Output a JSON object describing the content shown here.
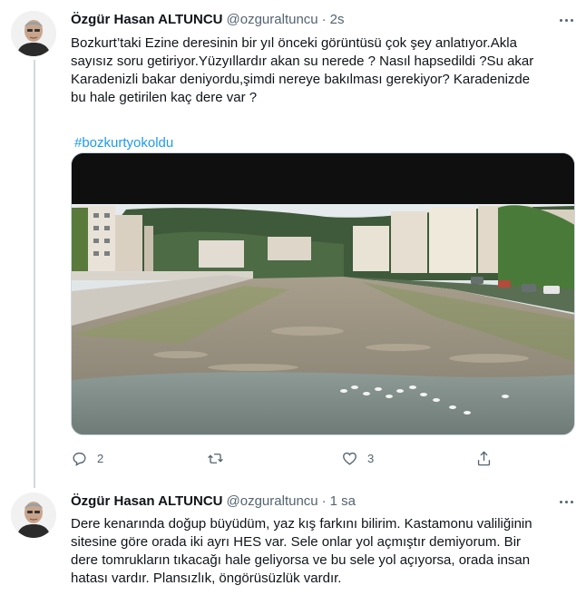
{
  "tweets": [
    {
      "author_name": "Özgür Hasan ALTUNCU",
      "handle": "@ozguraltuncu",
      "separator": "·",
      "time": "2s",
      "text_lines": [
        "Bozkurt’taki Ezine deresinin bir yıl önceki görüntüsü çok şey anlatıyor.Akla",
        "sayısız soru getiriyor.Yüzyıllardır akan su nerede ? Nasıl hapsedildi ?Su akar",
        "Karadenizli bakar deniyordu,şimdi nereye bakılması gerekiyor? Karadenizde",
        "bu hale getirilen kaç dere var ?"
      ],
      "hashtag": "#bozkurtyokoldu",
      "media_description_icon": "photo-river-image",
      "actions": {
        "reply_icon": "reply-icon",
        "reply_count": "2",
        "retweet_icon": "retweet-icon",
        "like_icon": "like-icon",
        "like_count": "3",
        "share_icon": "share-icon"
      }
    },
    {
      "author_name": "Özgür Hasan ALTUNCU",
      "handle": "@ozguraltuncu",
      "separator": "·",
      "time": "1 sa",
      "text_lines": [
        "Dere kenarında doğup büyüdüm, yaz kış farkını bilirim. Kastamonu valiliğinin",
        "sitesine göre orada iki ayrı HES var. Sele onlar yol açmıştır demiyorum. Bir",
        "dere tomrukların tıkacağı hale geliyorsa ve bu sele yol açıyorsa, orada insan",
        "hatası vardır. Plansızlık, öngörüsüzlük vardır."
      ]
    }
  ],
  "colors": {
    "text": "#0f1419",
    "secondary": "#536471",
    "link": "#1d9bf0",
    "thread_line": "#cfd9de"
  }
}
